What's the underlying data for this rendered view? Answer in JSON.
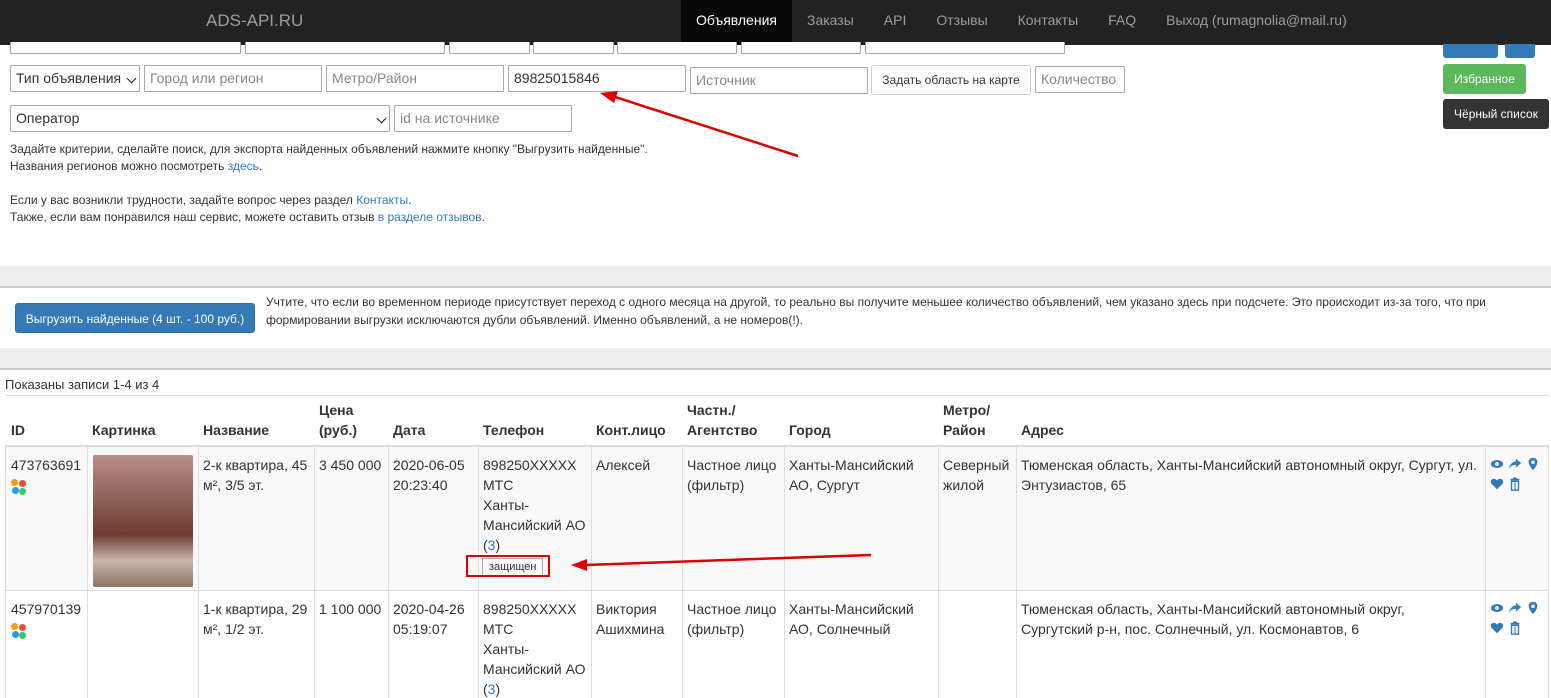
{
  "navbar": {
    "brand": "ADS-API.RU",
    "items": [
      {
        "label": "Объявления",
        "active": true
      },
      {
        "label": "Заказы"
      },
      {
        "label": "API"
      },
      {
        "label": "Отзывы"
      },
      {
        "label": "Контакты"
      },
      {
        "label": "FAQ"
      },
      {
        "label": "Выход (rumagnolia@mail.ru)"
      }
    ]
  },
  "filters": {
    "row2": {
      "type_select": "Тип объявления",
      "city_placeholder": "Город или регион",
      "metro_placeholder": "Метро/Район",
      "phone_value": "89825015846",
      "source_placeholder": "Источник",
      "map_button": "Задать область на карте",
      "count_placeholder": "Количество"
    },
    "row3": {
      "operator_select": "Оператор",
      "source_id_placeholder": "id на источнике"
    }
  },
  "side_buttons": {
    "favorites": "Избранное",
    "blacklist": "Чёрный список"
  },
  "info": {
    "line1": "Задайте критерии, сделайте поиск, для экспорта найденных объявлений нажмите кнопку \"Выгрузить найденные\".",
    "line2_prefix": "Названия регионов можно посмотреть ",
    "line2_link": "здесь",
    "line2_suffix": ".",
    "line3_prefix": "Если у вас возникли трудности, задайте вопрос через раздел ",
    "line3_link": "Контакты",
    "line3_suffix": ".",
    "line4_prefix": "Также, если вам понравился наш сервис, можете оставить отзыв ",
    "line4_link": "в разделе отзывов",
    "line4_suffix": "."
  },
  "export": {
    "button": "Выгрузить найденные (4 шт. - 100 руб.)",
    "note": "Учтите, что если во временном периоде присутствует переход с одного месяца на другой, то реально вы получите меньшее количество объявлений, чем указано здесь при подсчете. Это происходит из-за того, что при формировании выгрузки исключаются дубли объявлений. Именно объявлений, а не номеров(!)."
  },
  "table": {
    "shown": "Показаны записи 1-4 из 4",
    "headers": {
      "id": "ID",
      "picture": "Картинка",
      "name": "Название",
      "price_1": "Цена",
      "price_2": "(руб.)",
      "date": "Дата",
      "phone": "Телефон",
      "contact": "Конт.лицо",
      "type_1": "Частн./",
      "type_2": "Агентство",
      "city": "Город",
      "metro_1": "Метро/",
      "metro_2": "Район",
      "address": "Адрес"
    },
    "rows": [
      {
        "id": "473763691",
        "name_1": "2-к квартира, 45",
        "name_2": "м², 3/5 эт.",
        "price": "3 450 000",
        "date_1": "2020-06-05",
        "date_2": "20:23:40",
        "phone_1": "898250XXXXX",
        "phone_2": "МТС",
        "phone_3": "Ханты-",
        "phone_4": "Мансийский АО",
        "phone_count": "3",
        "protected": "защищен",
        "contact_1": "Алексей",
        "contact_2": "",
        "type_1": "Частное лицо",
        "type_2": "(фильтр)",
        "city_1": "Ханты-Мансийский",
        "city_2": "АО, Сургут",
        "metro_1": "Северный",
        "metro_2": "жилой",
        "address_1": "Тюменская область, Ханты-Мансийский автономный округ, Сургут, ул.",
        "address_2": "Энтузиастов, 65"
      },
      {
        "id": "457970139",
        "name_1": "1-к квартира, 29",
        "name_2": "м², 1/2 эт.",
        "price": "1 100 000",
        "date_1": "2020-04-26",
        "date_2": "05:19:07",
        "phone_1": "898250XXXXX",
        "phone_2": "МТС",
        "phone_3": "Ханты-",
        "phone_4": "Мансийский АО",
        "phone_count": "3",
        "contact_1": "Виктория",
        "contact_2": "Ашихмина",
        "type_1": "Частное лицо",
        "type_2": "(фильтр)",
        "city_1": "Ханты-Мансийский",
        "city_2": "АО, Солнечный",
        "metro_1": "",
        "metro_2": "",
        "address_1": "Тюменская область, Ханты-Мансийский автономный округ,",
        "address_2": "Сургутский р-н, пос. Солнечный, ул. Космонавтов, 6"
      }
    ]
  },
  "colors": {
    "navbar": "#222222",
    "link": "#337ab7",
    "success": "#5cb85c",
    "annotation": "#dd0000"
  }
}
